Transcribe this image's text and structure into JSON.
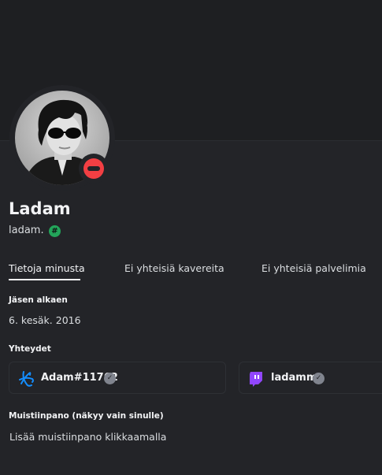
{
  "profile": {
    "display_name": "Ladam",
    "username": "ladam.",
    "badge_icon": "hash-badge-icon",
    "status": "do-not-disturb",
    "hash_symbol": "#"
  },
  "tabs": [
    {
      "label": "Tietoja minusta",
      "active": true
    },
    {
      "label": "Ei yhteisiä kavereita",
      "active": false
    },
    {
      "label": "Ei yhteisiä palvelimia",
      "active": false
    }
  ],
  "member_since": {
    "label": "Jäsen alkaen",
    "value": "6. kesäk. 2016"
  },
  "connections": {
    "label": "Yhteydet",
    "items": [
      {
        "service": "battle-net",
        "name": "Adam#11762",
        "verified": true,
        "icon": "battlenet-icon"
      },
      {
        "service": "twitch",
        "name": "ladamm",
        "verified": true,
        "icon": "twitch-icon"
      }
    ]
  },
  "note": {
    "label": "Muistiinpano (näkyy vain sinulle)",
    "placeholder": "Lisää muistiinpano klikkaamalla"
  },
  "colors": {
    "background": "#232428",
    "banner": "#1e1f22",
    "status_dnd": "#f23f43",
    "badge_green": "#23a55a",
    "twitch_purple": "#9146ff",
    "battlenet_blue": "#148eff"
  }
}
